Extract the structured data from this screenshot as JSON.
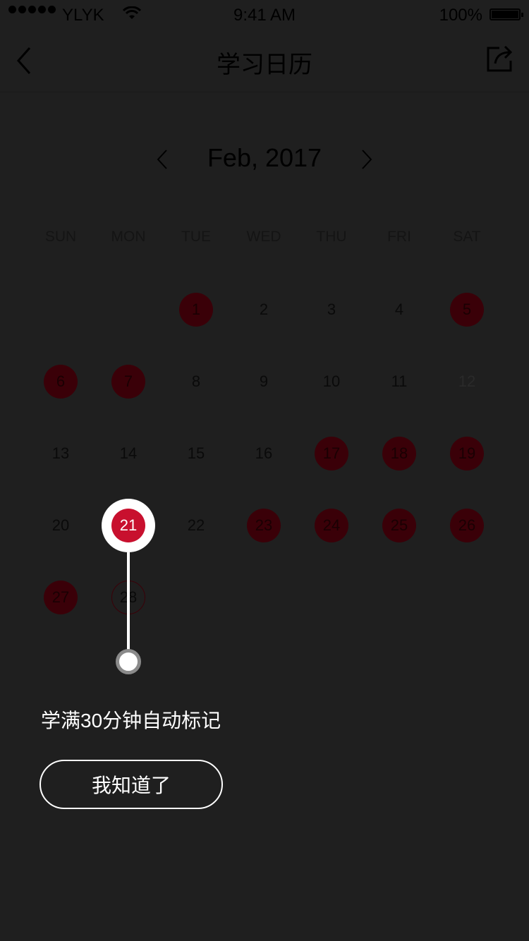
{
  "status_bar": {
    "carrier": "YLYK",
    "time": "9:41 AM",
    "battery": "100%"
  },
  "nav": {
    "title": "学习日历",
    "back_icon": "chevron-left-icon",
    "share_icon": "share-icon"
  },
  "calendar": {
    "month_label": "Feb, 2017",
    "weekdays": [
      "SUN",
      "MON",
      "TUE",
      "WED",
      "THU",
      "FRI",
      "SAT"
    ],
    "first_weekday_index": 2,
    "days": [
      {
        "day": "1",
        "state": "studied"
      },
      {
        "day": "2",
        "state": "normal"
      },
      {
        "day": "3",
        "state": "normal"
      },
      {
        "day": "4",
        "state": "normal"
      },
      {
        "day": "5",
        "state": "studied"
      },
      {
        "day": "6",
        "state": "studied"
      },
      {
        "day": "7",
        "state": "studied"
      },
      {
        "day": "8",
        "state": "normal"
      },
      {
        "day": "9",
        "state": "normal"
      },
      {
        "day": "10",
        "state": "normal"
      },
      {
        "day": "11",
        "state": "normal"
      },
      {
        "day": "12",
        "state": "dim"
      },
      {
        "day": "13",
        "state": "normal"
      },
      {
        "day": "14",
        "state": "normal"
      },
      {
        "day": "15",
        "state": "normal"
      },
      {
        "day": "16",
        "state": "normal"
      },
      {
        "day": "17",
        "state": "studied"
      },
      {
        "day": "18",
        "state": "studied"
      },
      {
        "day": "19",
        "state": "studied"
      },
      {
        "day": "20",
        "state": "normal"
      },
      {
        "day": "21",
        "state": "highlighted"
      },
      {
        "day": "22",
        "state": "normal"
      },
      {
        "day": "23",
        "state": "studied"
      },
      {
        "day": "24",
        "state": "studied"
      },
      {
        "day": "25",
        "state": "studied"
      },
      {
        "day": "26",
        "state": "studied"
      },
      {
        "day": "27",
        "state": "studied"
      },
      {
        "day": "28",
        "state": "today"
      }
    ]
  },
  "guide": {
    "highlighted_day": "21",
    "tip": "学满30分钟自动标记",
    "button_label": "我知道了"
  },
  "colors": {
    "accent": "#c8102e",
    "overlay": "#1f1f1f"
  }
}
